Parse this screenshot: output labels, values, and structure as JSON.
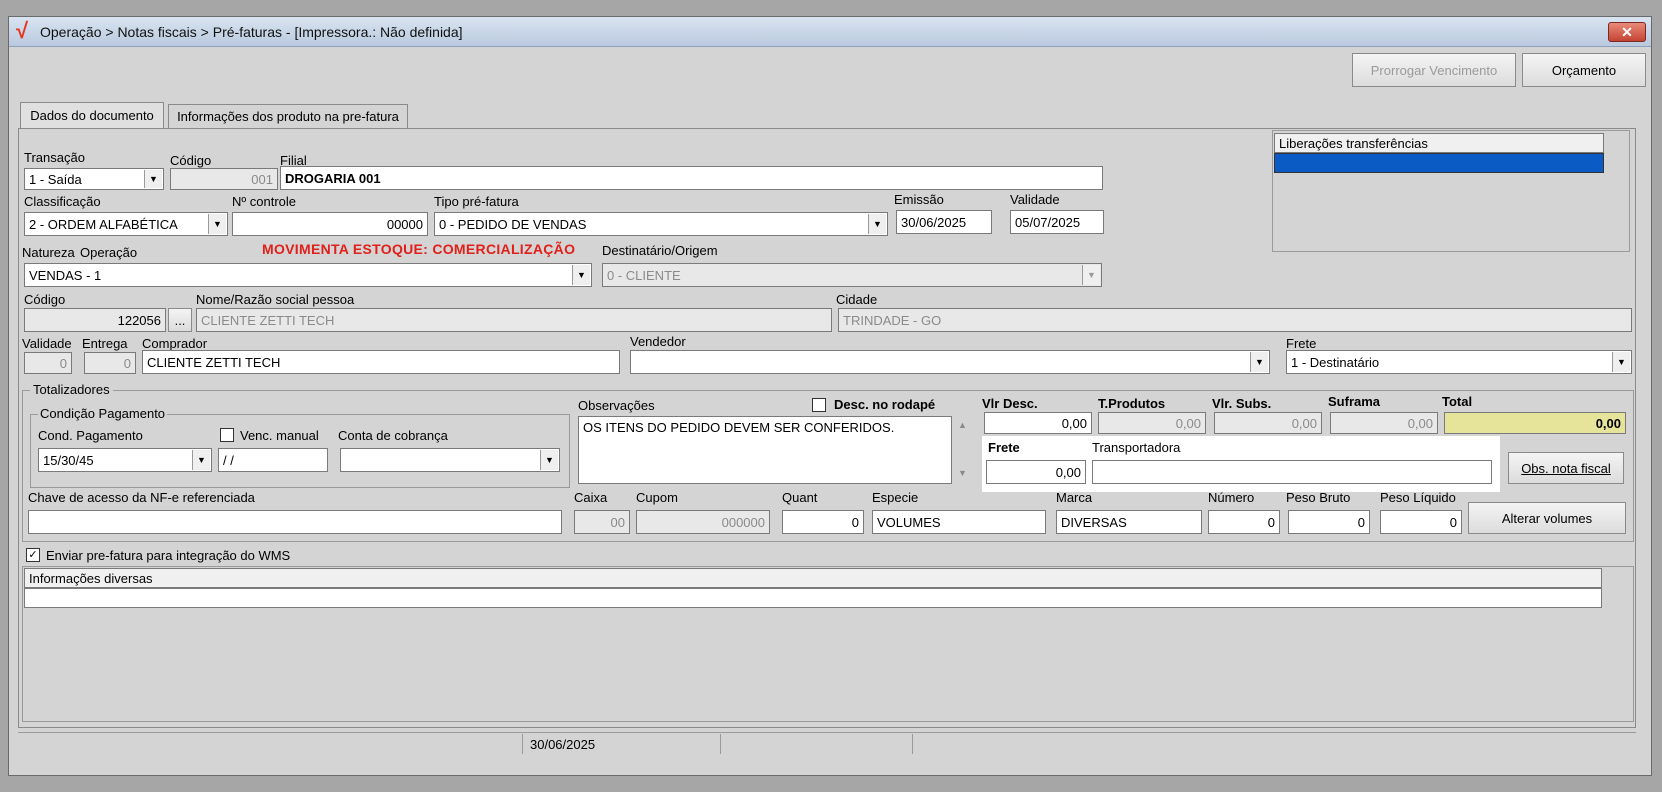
{
  "window": {
    "title": "Operação > Notas fiscais > Pré-faturas - [Impressora.: Não definida]",
    "close_glyph": "✕",
    "logo_glyph": "√",
    "logo_color": "#e8341c"
  },
  "toolbar": {
    "prorrogar_label": "Prorrogar Vencimento",
    "orcamento_label": "Orçamento"
  },
  "tabs": [
    {
      "label": "Dados do documento"
    },
    {
      "label": "Informações dos produto na pre-fatura"
    }
  ],
  "form": {
    "transacao": {
      "label": "Transação",
      "value": "1 - Saída"
    },
    "codigo": {
      "label": "Código",
      "value": "001"
    },
    "filial": {
      "label": "Filial",
      "value": "DROGARIA 001"
    },
    "classificacao": {
      "label": "Classificação",
      "value": "2 - ORDEM ALFABÉTICA"
    },
    "n_controle": {
      "label": "Nº controle",
      "value": "00000"
    },
    "tipo_prefatura": {
      "label": "Tipo pré-fatura",
      "value": "0 - PEDIDO DE VENDAS"
    },
    "emissao": {
      "label": "Emissão",
      "value": "30/06/2025"
    },
    "validade": {
      "label": "Validade",
      "value": "05/07/2025"
    },
    "natureza_label": "Natureza",
    "operacao_label": "Operação",
    "movimenta_estoque": "MOVIMENTA ESTOQUE: COMERCIALIZAÇÃO",
    "movimenta_color": "#e0201a",
    "natureza_value": "VENDAS - 1",
    "destinatario": {
      "label": "Destinatário/Origem",
      "value": "0 - CLIENTE"
    },
    "pessoa_codigo": {
      "label": "Código",
      "value": "122056"
    },
    "ellipsis": "...",
    "nome": {
      "label": "Nome/Razão social pessoa",
      "value": "CLIENTE ZETTI TECH"
    },
    "cidade": {
      "label": "Cidade",
      "value": "TRINDADE - GO"
    },
    "validade2": {
      "label": "Validade",
      "value": "0"
    },
    "entrega": {
      "label": "Entrega",
      "value": "0"
    },
    "comprador": {
      "label": "Comprador",
      "value": "CLIENTE ZETTI TECH"
    },
    "vendedor": {
      "label": "Vendedor",
      "value": ""
    },
    "frete_tipo": {
      "label": "Frete",
      "value": "1 - Destinatário"
    }
  },
  "liberacoes": {
    "header": "Liberações transferências"
  },
  "totalizadores": {
    "title": "Totalizadores",
    "condicao_title": "Condição Pagamento",
    "cond_pagamento": {
      "label": "Cond. Pagamento",
      "value": "15/30/45"
    },
    "venc_manual": {
      "label": "Venc. manual",
      "value": "/ /"
    },
    "conta_cobranca": {
      "label": "Conta de cobrança",
      "value": ""
    },
    "observacoes": {
      "label": "Observações",
      "value": "OS ITENS DO PEDIDO DEVEM SER CONFERIDOS."
    },
    "desc_rodape": "Desc. no rodapé",
    "vlr_desc": {
      "label": "Vlr Desc.",
      "value": "0,00"
    },
    "t_produtos": {
      "label": "T.Produtos",
      "value": "0,00"
    },
    "vlr_subs": {
      "label": "Vlr. Subs.",
      "value": "0,00"
    },
    "suframa": {
      "label": "Suframa",
      "value": "0,00"
    },
    "total": {
      "label": "Total",
      "value": "0,00"
    },
    "total_color": "#e6e49a",
    "frete": {
      "label": "Frete",
      "value": "0,00"
    },
    "transportadora": {
      "label": "Transportadora",
      "value": ""
    },
    "obs_nota_label": "Obs. nota fiscal",
    "chave_acesso": {
      "label": "Chave de acesso da NF-e referenciada",
      "value": ""
    },
    "caixa": {
      "label": "Caixa",
      "value": "00"
    },
    "cupom": {
      "label": "Cupom",
      "value": "000000"
    },
    "quant": {
      "label": "Quant",
      "value": "0"
    },
    "especie": {
      "label": "Especie",
      "value": "VOLUMES"
    },
    "marca": {
      "label": "Marca",
      "value": "DIVERSAS"
    },
    "numero": {
      "label": "Número",
      "value": "0"
    },
    "peso_bruto": {
      "label": "Peso Bruto",
      "value": "0"
    },
    "peso_liquido": {
      "label": "Peso Líquido",
      "value": "0"
    },
    "alterar_volumes_label": "Alterar volumes"
  },
  "wms": {
    "label": "Enviar pre-fatura para integração do WMS",
    "check": "✓"
  },
  "info_diversas": {
    "header": "Informações diversas"
  },
  "status_bar": {
    "date": "30/06/2025"
  },
  "glyphs": {
    "dropdown": "▼",
    "up": "▲",
    "down": "▼"
  }
}
